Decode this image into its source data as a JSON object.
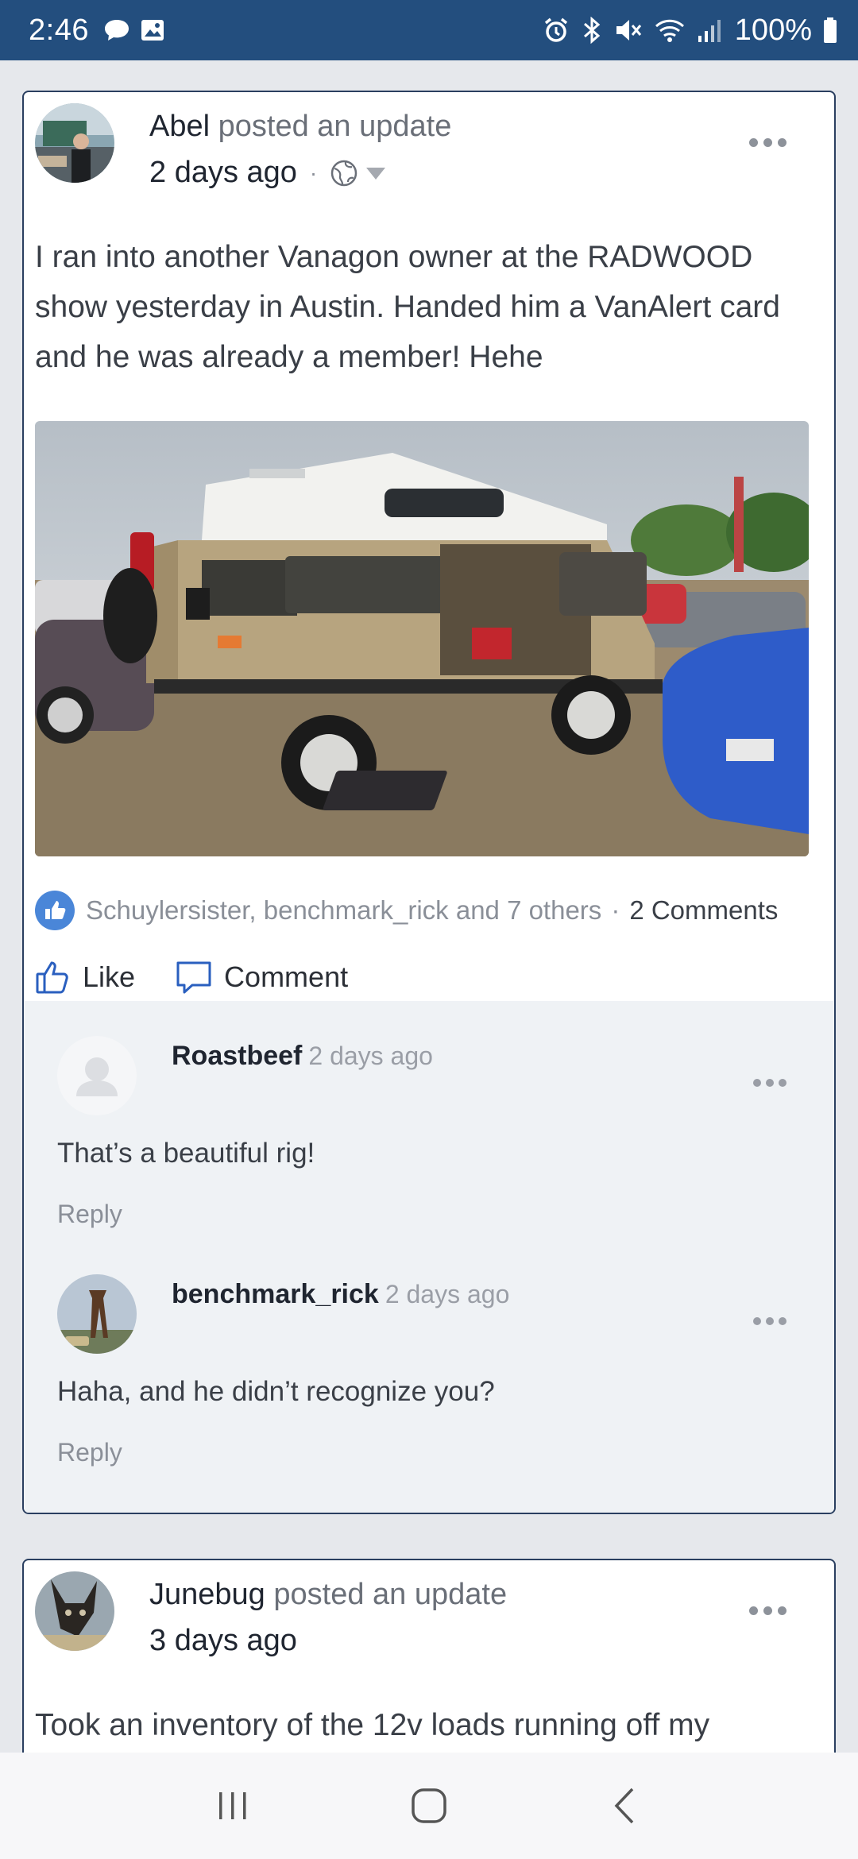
{
  "status_bar": {
    "time": "2:46",
    "battery": "100%"
  },
  "posts": [
    {
      "author": "Abel",
      "action": " posted an update",
      "time": "2 days ago",
      "privacy_icon": "globe-icon",
      "text": "I ran into another Vanagon owner at the RADWOOD show yesterday in Austin. Handed him a VanAlert card and he was already a member! Hehe",
      "likers": "Schuylersister, benchmark_rick and 7 others",
      "comments_count": "2 Comments",
      "like_label": "Like",
      "comment_label": "Comment",
      "comments": [
        {
          "author": "Roastbeef",
          "time": "2 days ago",
          "text": "That’s a beautiful rig!",
          "reply": "Reply"
        },
        {
          "author": "benchmark_rick",
          "time": "2 days ago",
          "text": "Haha, and he didn’t recognize you?",
          "reply": "Reply"
        }
      ]
    },
    {
      "author": "Junebug",
      "action": " posted an update",
      "time": "3 days ago",
      "text": "Took an inventory of the 12v loads running off my"
    }
  ],
  "colors": {
    "header_blue": "#234e7e",
    "like_blue": "#4a86d8",
    "card_border": "#2a3f60"
  }
}
